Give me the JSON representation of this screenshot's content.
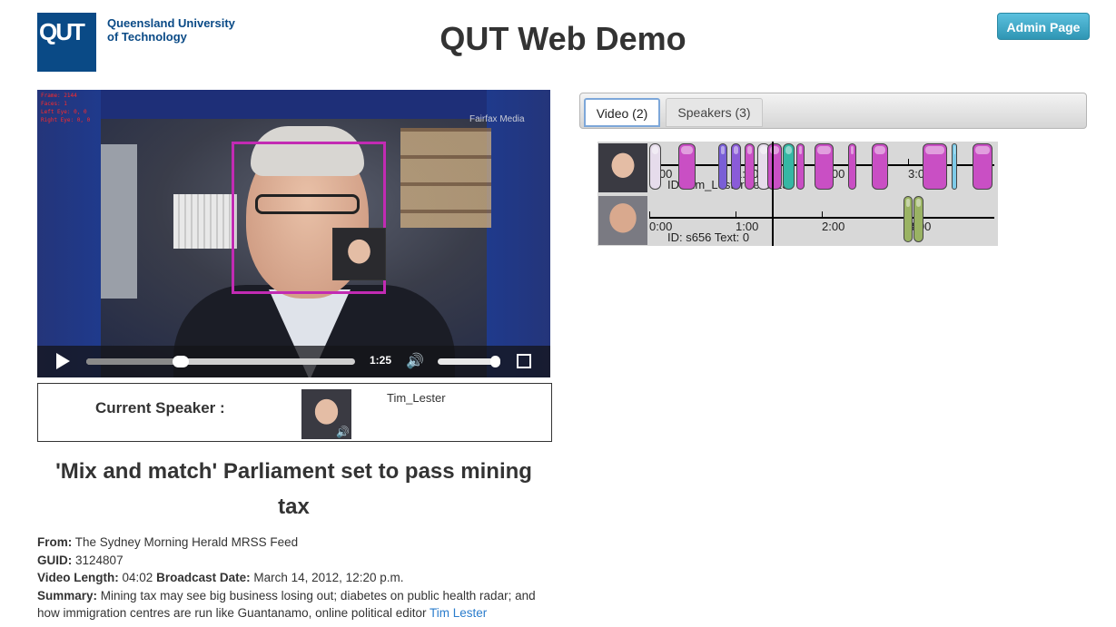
{
  "header": {
    "logo_mark": "QUT",
    "logo_line1": "Queensland University",
    "logo_line2": "of Technology",
    "title": "QUT Web Demo",
    "admin_button": "Admin Page"
  },
  "video": {
    "watermark": "Fairfax Media",
    "debug_lines": [
      "Frame: 2144",
      "Faces: 1",
      "Left Eye: 0, 0",
      "Right Eye: 0, 0"
    ],
    "current_time": "1:25",
    "progress_fraction": 0.35,
    "volume_fraction": 0.95
  },
  "current_speaker": {
    "label": "Current Speaker :",
    "name": "Tim_Lester"
  },
  "article": {
    "title": "'Mix and match' Parliament set to pass mining tax",
    "from_label": "From:",
    "from_value": "The Sydney Morning Herald MRSS Feed",
    "guid_label": "GUID:",
    "guid_value": "3124807",
    "length_label": "Video Length:",
    "length_value": "04:02",
    "broadcast_label": "Broadcast Date:",
    "broadcast_value": "March 14, 2012, 12:20 p.m.",
    "summary_label": "Summary:",
    "summary_value": "Mining tax may see big business losing out; diabetes on public health radar; and how immigration centres are run like Guantanamo, online political editor",
    "summary_link": "Tim Lester"
  },
  "tabs": [
    {
      "label": "Video (2)",
      "active": true
    },
    {
      "label": "Speakers (3)",
      "active": false
    }
  ],
  "timeline": {
    "duration_seconds": 242,
    "current_seconds": 85,
    "tick_labels": [
      "0:00",
      "1:00",
      "2:00",
      "3:00"
    ],
    "rows": [
      {
        "id_text": "ID: Tim_Lester Text: 13",
        "segments": [
          {
            "start": 0,
            "end": 8,
            "color": "#e6dceb"
          },
          {
            "start": 20,
            "end": 32,
            "color": "#c94fc4"
          },
          {
            "start": 48,
            "end": 54,
            "color": "#7a5fd6"
          },
          {
            "start": 57,
            "end": 64,
            "color": "#8a5bd8"
          },
          {
            "start": 66,
            "end": 73,
            "color": "#c94fc4"
          },
          {
            "start": 75,
            "end": 84,
            "color": "#e6dceb"
          },
          {
            "start": 82,
            "end": 92,
            "color": "#c94fc4"
          },
          {
            "start": 93,
            "end": 101,
            "color": "#35b7a4"
          },
          {
            "start": 102,
            "end": 108,
            "color": "#c94fc4"
          },
          {
            "start": 115,
            "end": 128,
            "color": "#c94fc4"
          },
          {
            "start": 138,
            "end": 144,
            "color": "#c94fc4"
          },
          {
            "start": 155,
            "end": 166,
            "color": "#c94fc4"
          },
          {
            "start": 190,
            "end": 207,
            "color": "#c94fc4"
          },
          {
            "start": 210,
            "end": 214,
            "color": "#7ecbe8"
          },
          {
            "start": 225,
            "end": 239,
            "color": "#c94fc4"
          }
        ]
      },
      {
        "id_text": "ID: s656 Text: 0",
        "segments": [
          {
            "start": 177,
            "end": 183,
            "color": "#9ab363"
          },
          {
            "start": 184,
            "end": 191,
            "color": "#9ab363"
          }
        ]
      }
    ]
  }
}
